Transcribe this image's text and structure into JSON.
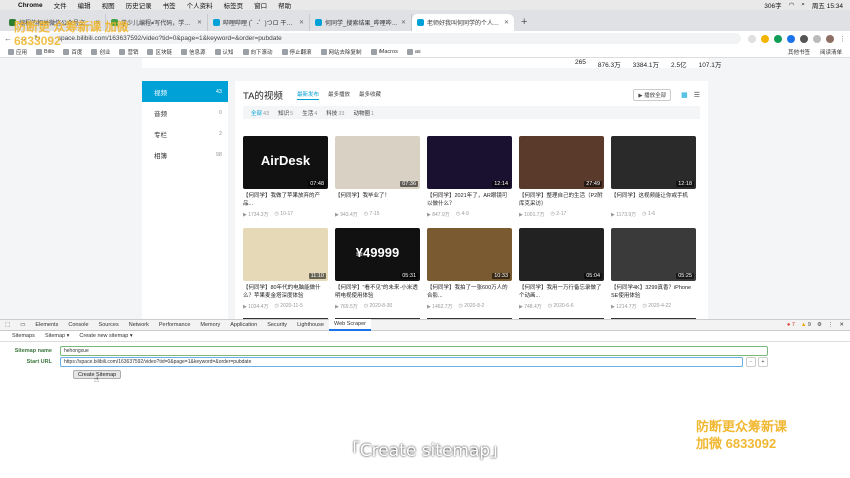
{
  "menubar": {
    "app": "Chrome",
    "items": [
      "文件",
      "编辑",
      "视图",
      "历史记录",
      "书签",
      "个人资料",
      "标签页",
      "窗口",
      "帮助"
    ],
    "status": "周五 15:34",
    "battery": "306字"
  },
  "tabs": [
    {
      "title": "编程的相关微信公众号文章 - 简",
      "color": "#2e7d32"
    },
    {
      "title": "学少儿编程≠写代码，学的是编",
      "color": "#43a047"
    },
    {
      "title": "哔哩哔哩 (゜-゜)つロ 干杯~-bilib",
      "color": "#00a1d6"
    },
    {
      "title": "何同学_搜索结果_哔哩哔哩_Bilib",
      "color": "#00a1d6"
    },
    {
      "title": "老师好我叫何同学的个人空间_哔",
      "color": "#00a1d6"
    }
  ],
  "url": "space.bilibili.com/163637592/video?tid=0&page=1&keyword=&order=pubdate",
  "bookmarks": [
    "应用",
    "Bilib",
    "百度",
    "创业",
    "营销",
    "区块链",
    "信息源",
    "认知",
    "向下滚动",
    "停止翻滚",
    "网站去除复制",
    "iMacros",
    "as"
  ],
  "bookmarks_right": [
    "其他书签",
    "阅读清单"
  ],
  "stats": [
    "265",
    "876.3万",
    "3384.1万",
    "2.5亿",
    "107.1万"
  ],
  "sidebar": [
    {
      "label": "视频",
      "count": "43"
    },
    {
      "label": "音频",
      "count": "0"
    },
    {
      "label": "专栏",
      "count": "2"
    },
    {
      "label": "相簿",
      "count": "98"
    }
  ],
  "main": {
    "title": "TA的视频",
    "sorts": [
      "最新发布",
      "最多播放",
      "最多收藏"
    ],
    "play_all": "播放全部"
  },
  "filters": [
    {
      "label": "全部",
      "count": "43"
    },
    {
      "label": "知识",
      "count": "5"
    },
    {
      "label": "生活",
      "count": "4"
    },
    {
      "label": "科技",
      "count": "33"
    },
    {
      "label": "动物圈",
      "count": "1"
    }
  ],
  "videos": [
    {
      "title": "【何同学】我做了苹果放弃的产品...",
      "views": "1734.3万",
      "date": "10-17",
      "duration": "07:48",
      "bg": "#111111",
      "big": "AirDesk"
    },
    {
      "title": "【何同学】我毕业了！",
      "views": "943.4万",
      "date": "7-15",
      "duration": "07:36",
      "bg": "#d9d2c4",
      "big": ""
    },
    {
      "title": "【何同学】2021年了，AR眼镜可以做什么？",
      "views": "847.9万",
      "date": "4-9",
      "duration": "12:14",
      "bg": "#1a1030",
      "big": ""
    },
    {
      "title": "【何同学】整理自己的生活（P2附库克采访）",
      "views": "1001.7万",
      "date": "2-17",
      "duration": "27:49",
      "bg": "#5a3a2a",
      "big": ""
    },
    {
      "title": "【何同学】这视频能让你戒手机",
      "views": "1173.9万",
      "date": "1-6",
      "duration": "12:18",
      "bg": "#2a2a2a",
      "big": ""
    },
    {
      "title": "【何同学】80年代的电脑能做什么？苹果麦金塔深度体验",
      "views": "1034.4万",
      "date": "2020-11-5",
      "duration": "11:10",
      "bg": "#e6d9b8",
      "big": ""
    },
    {
      "title": "【何同学】\"看不见\"的未来·小米透明电视使用体验",
      "views": "769.5万",
      "date": "2020-8-30",
      "duration": "05:31",
      "bg": "#111111",
      "big": "¥49999"
    },
    {
      "title": "【何同学】我拍了一张600万人的合影...",
      "views": "1462.7万",
      "date": "2020-8-2",
      "duration": "10:33",
      "bg": "#7a5a30",
      "big": ""
    },
    {
      "title": "【何同学】我用一万行备忘录做了个动画...",
      "views": "748.4万",
      "date": "2020-6-6",
      "duration": "05:04",
      "bg": "#222222",
      "big": ""
    },
    {
      "title": "【何同学4K】3299真香？iPhone SE使用体验",
      "views": "1214.7万",
      "date": "2020-4-22",
      "duration": "05:25",
      "bg": "#3a3a3a",
      "big": ""
    }
  ],
  "devtools": {
    "tabs": [
      "Elements",
      "Console",
      "Sources",
      "Network",
      "Performance",
      "Memory",
      "Application",
      "Security",
      "Lighthouse",
      "Web Scraper"
    ],
    "active": "Web Scraper",
    "errors": "7",
    "warnings": "9"
  },
  "scraper": {
    "subtabs": [
      "Sitemaps",
      "Sitemap ▾",
      "Create new sitemap ▾"
    ],
    "name_label": "Sitemap name",
    "name_value": "hehongxue",
    "url_label": "Start URL",
    "url_value": "https://space.bilibili.com/163637592/video?tid=0&page=1&keyword=&order=pubdate",
    "button": "Create Sitemap"
  },
  "caption": "「Create sitemap」",
  "watermark": {
    "top": "防断更 众筹新课 加微 6833092",
    "bottom1": "防断更众筹新课",
    "bottom2": "加微 6833092"
  }
}
